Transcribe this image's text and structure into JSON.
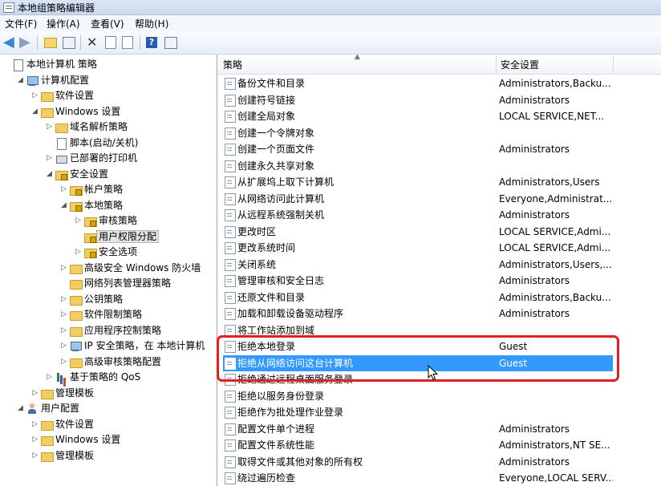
{
  "window": {
    "title": "本地组策略编辑器"
  },
  "menu": [
    "文件(F)",
    "操作(A)",
    "查看(V)",
    "帮助(H)"
  ],
  "tree": [
    {
      "label": "本地计算机 策略",
      "indent": 0,
      "exp": "",
      "icon": "doc"
    },
    {
      "label": "计算机配置",
      "indent": 1,
      "exp": "◢",
      "icon": "comp"
    },
    {
      "label": "软件设置",
      "indent": 2,
      "exp": "▷",
      "icon": "fold"
    },
    {
      "label": "Windows 设置",
      "indent": 2,
      "exp": "◢",
      "icon": "fold"
    },
    {
      "label": "域名解析策略",
      "indent": 3,
      "exp": "▷",
      "icon": "fold"
    },
    {
      "label": "脚本(启动/关机)",
      "indent": 3,
      "exp": "",
      "icon": "doc"
    },
    {
      "label": "已部署的打印机",
      "indent": 3,
      "exp": "▷",
      "icon": "printer"
    },
    {
      "label": "安全设置",
      "indent": 3,
      "exp": "◢",
      "icon": "lockfold"
    },
    {
      "label": "帐户策略",
      "indent": 4,
      "exp": "▷",
      "icon": "lockfold"
    },
    {
      "label": "本地策略",
      "indent": 4,
      "exp": "◢",
      "icon": "lockfold"
    },
    {
      "label": "审核策略",
      "indent": 5,
      "exp": "▷",
      "icon": "lockfold"
    },
    {
      "label": "用户权限分配",
      "indent": 5,
      "exp": "",
      "icon": "lockfold",
      "selected": true
    },
    {
      "label": "安全选项",
      "indent": 5,
      "exp": "▷",
      "icon": "lockfold"
    },
    {
      "label": "高级安全 Windows 防火墙",
      "indent": 4,
      "exp": "▷",
      "icon": "fold"
    },
    {
      "label": "网络列表管理器策略",
      "indent": 4,
      "exp": "",
      "icon": "fold"
    },
    {
      "label": "公钥策略",
      "indent": 4,
      "exp": "▷",
      "icon": "fold"
    },
    {
      "label": "软件限制策略",
      "indent": 4,
      "exp": "▷",
      "icon": "fold"
    },
    {
      "label": "应用程序控制策略",
      "indent": 4,
      "exp": "▷",
      "icon": "fold"
    },
    {
      "label": "IP 安全策略，在 本地计算机",
      "indent": 4,
      "exp": "▷",
      "icon": "comp"
    },
    {
      "label": "高级审核策略配置",
      "indent": 4,
      "exp": "▷",
      "icon": "fold"
    },
    {
      "label": "基于策略的 QoS",
      "indent": 3,
      "exp": "▷",
      "icon": "chart"
    },
    {
      "label": "管理模板",
      "indent": 2,
      "exp": "▷",
      "icon": "fold"
    },
    {
      "label": "用户配置",
      "indent": 1,
      "exp": "◢",
      "icon": "user"
    },
    {
      "label": "软件设置",
      "indent": 2,
      "exp": "▷",
      "icon": "fold"
    },
    {
      "label": "Windows 设置",
      "indent": 2,
      "exp": "▷",
      "icon": "fold"
    },
    {
      "label": "管理模板",
      "indent": 2,
      "exp": "▷",
      "icon": "fold"
    }
  ],
  "list": {
    "headers": {
      "policy": "策略",
      "setting": "安全设置"
    },
    "rows": [
      {
        "name": "备份文件和目录",
        "setting": "Administrators,Backu..."
      },
      {
        "name": "创建符号链接",
        "setting": "Administrators"
      },
      {
        "name": "创建全局对象",
        "setting": "LOCAL SERVICE,NET..."
      },
      {
        "name": "创建一个令牌对象",
        "setting": ""
      },
      {
        "name": "创建一个页面文件",
        "setting": "Administrators"
      },
      {
        "name": "创建永久共享对象",
        "setting": ""
      },
      {
        "name": "从扩展坞上取下计算机",
        "setting": "Administrators,Users"
      },
      {
        "name": "从网络访问此计算机",
        "setting": "Everyone,Administrat..."
      },
      {
        "name": "从远程系统强制关机",
        "setting": "Administrators"
      },
      {
        "name": "更改时区",
        "setting": "LOCAL SERVICE,Admi..."
      },
      {
        "name": "更改系统时间",
        "setting": "LOCAL SERVICE,Admi..."
      },
      {
        "name": "关闭系统",
        "setting": "Administrators,Users,..."
      },
      {
        "name": "管理审核和安全日志",
        "setting": "Administrators"
      },
      {
        "name": "还原文件和目录",
        "setting": "Administrators,Backu..."
      },
      {
        "name": "加载和卸载设备驱动程序",
        "setting": "Administrators"
      },
      {
        "name": "将工作站添加到域",
        "setting": ""
      },
      {
        "name": "拒绝本地登录",
        "setting": "Guest"
      },
      {
        "name": "拒绝从网络访问这台计算机",
        "setting": "Guest",
        "selected": true
      },
      {
        "name": "拒绝通过远程桌面服务登录",
        "setting": ""
      },
      {
        "name": "拒绝以服务身份登录",
        "setting": ""
      },
      {
        "name": "拒绝作为批处理作业登录",
        "setting": ""
      },
      {
        "name": "配置文件单个进程",
        "setting": "Administrators"
      },
      {
        "name": "配置文件系统性能",
        "setting": "Administrators,NT SE..."
      },
      {
        "name": "取得文件或其他对象的所有权",
        "setting": "Administrators"
      },
      {
        "name": "绕过遍历检查",
        "setting": "Everyone,LOCAL SERV..."
      }
    ]
  },
  "colors": {
    "selection": "#3399ff",
    "highlight_box": "#e01e24"
  }
}
